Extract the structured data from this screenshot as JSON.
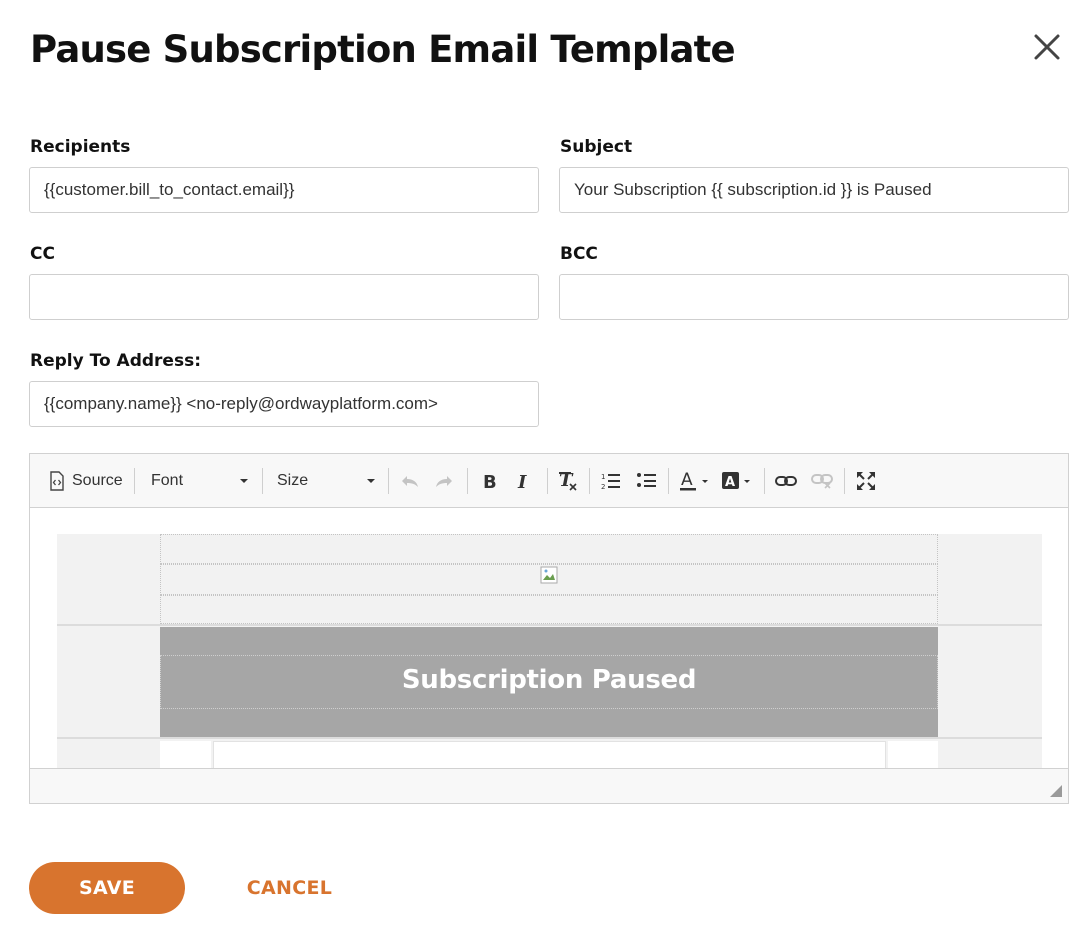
{
  "dialog": {
    "title": "Pause Subscription Email Template"
  },
  "form": {
    "recipients": {
      "label": "Recipients",
      "value": "{{customer.bill_to_contact.email}}"
    },
    "subject": {
      "label": "Subject",
      "value": "Your Subscription {{ subscription.id }} is Paused"
    },
    "cc": {
      "label": "CC",
      "value": ""
    },
    "bcc": {
      "label": "BCC",
      "value": ""
    },
    "reply_to": {
      "label": "Reply To Address:",
      "value": "{{company.name}} <no-reply@ordwayplatform.com>"
    }
  },
  "editor": {
    "toolbar": {
      "source_label": "Source",
      "font_label": "Font",
      "size_label": "Size",
      "icons": [
        "source-icon",
        "undo-icon",
        "redo-icon",
        "bold-icon",
        "italic-icon",
        "remove-format-icon",
        "numbered-list-icon",
        "bulleted-list-icon",
        "text-color-icon",
        "background-color-icon",
        "link-icon",
        "unlink-icon",
        "maximize-icon"
      ]
    },
    "content": {
      "banner_heading": "Subscription Paused",
      "banner_color": "#a6a6a6"
    }
  },
  "actions": {
    "save_label": "SAVE",
    "cancel_label": "CANCEL"
  },
  "colors": {
    "accent": "#d8742e"
  }
}
